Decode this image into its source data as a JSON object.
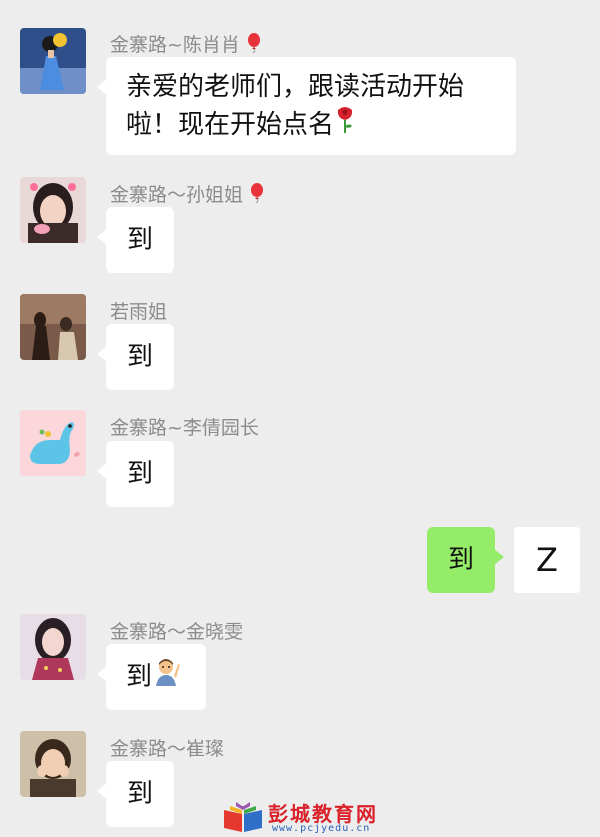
{
  "messages": [
    {
      "sender": "金寨路~陈肖肖",
      "text_line1": "亲爱的老师们，跟读活动开始",
      "text_line2": "啦！现在开始点名"
    },
    {
      "sender": "金寨路～孙姐姐",
      "text": "到"
    },
    {
      "sender": "若雨姐",
      "text": "到"
    },
    {
      "sender": "金寨路~李倩园长",
      "text": "到"
    },
    {
      "sender": "",
      "text": "到",
      "avatar_letter": "Z"
    },
    {
      "sender": "金寨路～金晓雯",
      "text": "到"
    },
    {
      "sender": "金寨路～崔璨",
      "text": "到"
    }
  ],
  "watermark": {
    "title": "彭城教育网",
    "url": "www.pcjyedu.cn"
  },
  "icons": [
    "balloon-icon",
    "rose-icon",
    "raising-hand-person-icon",
    "book-logo-icon"
  ],
  "colors": {
    "background": "#ededed",
    "bubble_incoming": "#ffffff",
    "bubble_outgoing": "#95ec69",
    "sender_name": "#8c8c8c"
  }
}
